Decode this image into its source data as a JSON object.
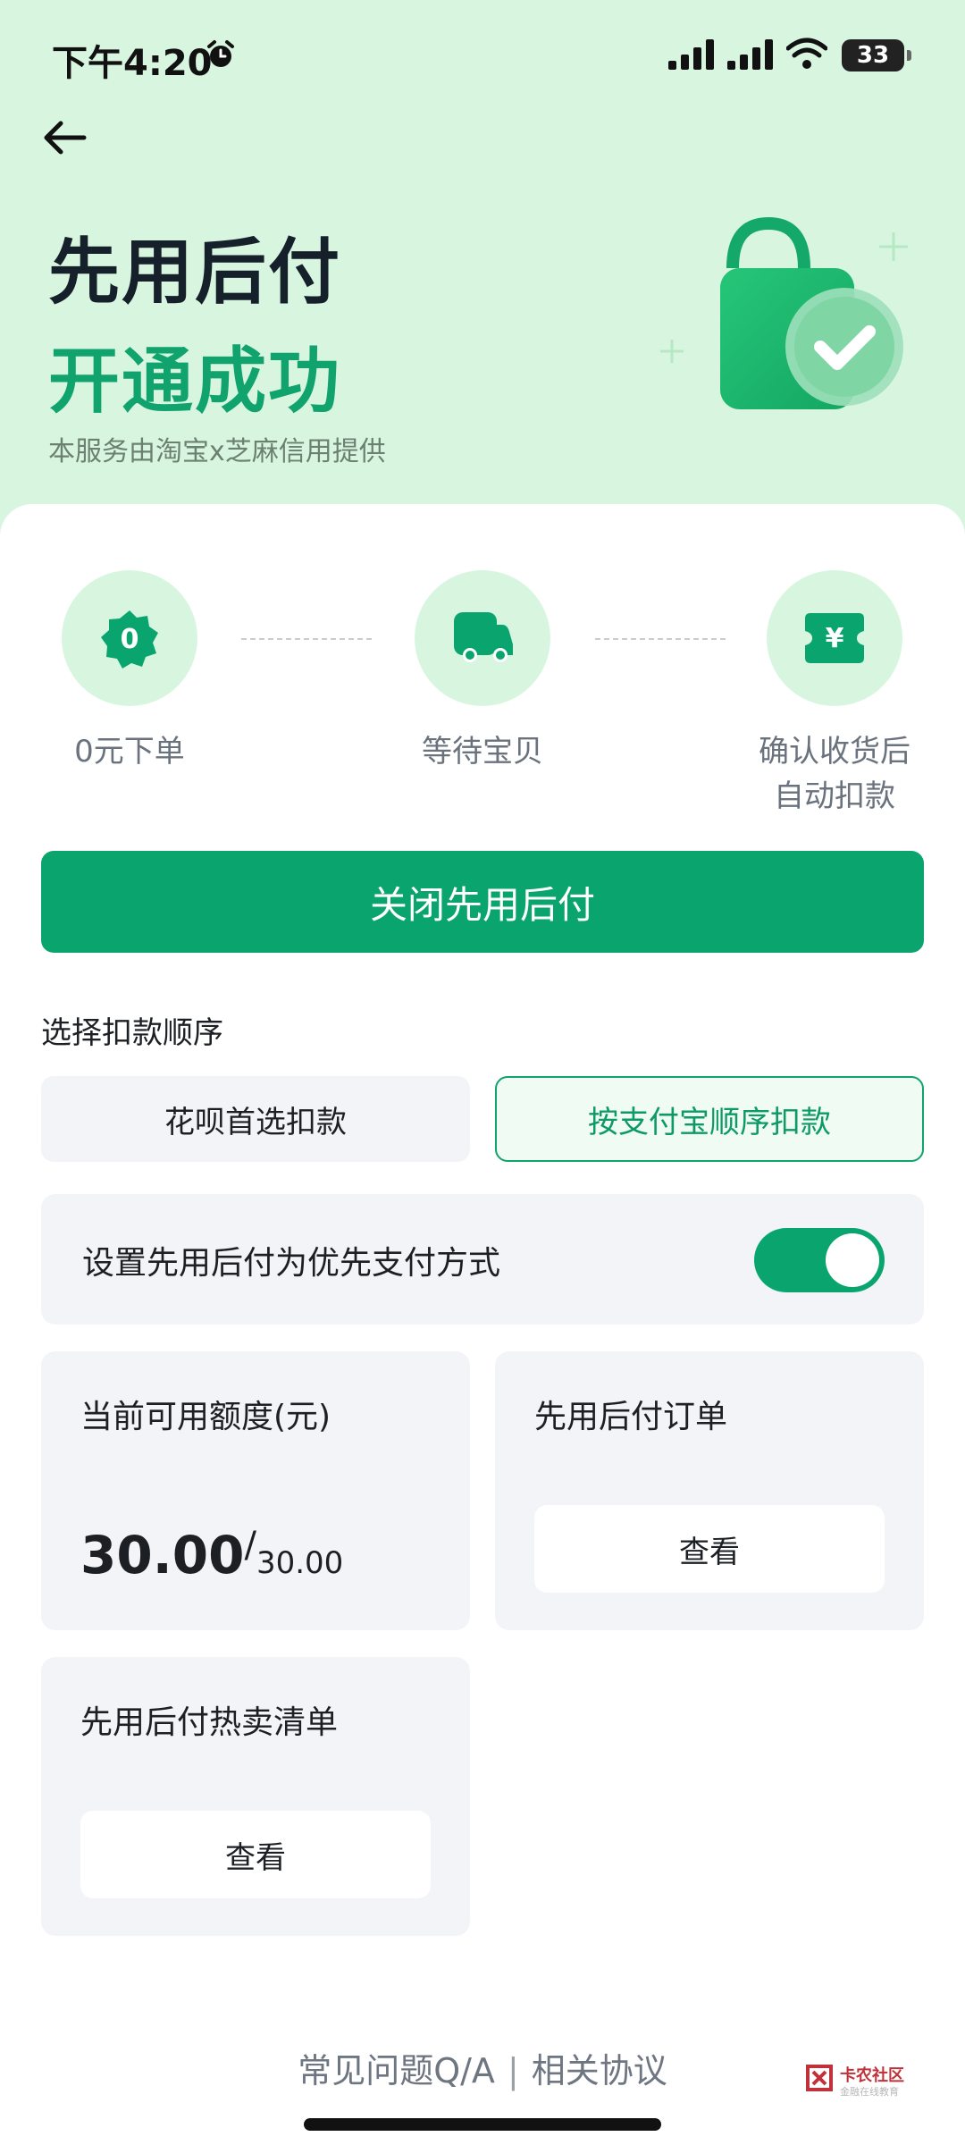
{
  "status_bar": {
    "time": "下午4:20",
    "battery": "33",
    "icons": [
      "alarm-icon",
      "cell-signal-icon",
      "cell-signal-icon",
      "wifi-icon",
      "battery-icon"
    ]
  },
  "header": {
    "back_icon": "arrow-left-icon",
    "title_line1": "先用后付",
    "title_line2": "开通成功",
    "subtitle": "本服务由淘宝x芝麻信用提供",
    "illustration": "shopping-bag-check-icon"
  },
  "colors": {
    "accent": "#0aa56f",
    "hero_bg": "#d8f6df",
    "card_bg": "#f2f4f8",
    "text": "#1c1f23",
    "muted": "#6a737d"
  },
  "steps": [
    {
      "icon": "zero-badge-icon",
      "badge": "0",
      "label": "0元下单"
    },
    {
      "icon": "truck-icon",
      "label": "等待宝贝"
    },
    {
      "icon": "yuan-ticket-icon",
      "badge": "¥",
      "label_line1": "确认收货后",
      "label_line2": "自动扣款"
    }
  ],
  "primary_button": "关闭先用后付",
  "deduction": {
    "label": "选择扣款顺序",
    "options": [
      "花呗首选扣款",
      "按支付宝顺序扣款"
    ],
    "selected": "按支付宝顺序扣款"
  },
  "priority_toggle": {
    "label": "设置先用后付为优先支付方式",
    "on": true
  },
  "credit_card": {
    "title": "当前可用额度(元)",
    "available": "30.00",
    "separator": "/",
    "total": "30.00"
  },
  "orders_card": {
    "title": "先用后付订单",
    "button": "查看"
  },
  "hot_list_card": {
    "title": "先用后付热卖清单",
    "button": "查看"
  },
  "footer": {
    "faq": "常见问题Q/A",
    "separator": "|",
    "agreement": "相关协议"
  },
  "watermark": {
    "name": "卡农社区",
    "sub": "金融在线教育"
  }
}
